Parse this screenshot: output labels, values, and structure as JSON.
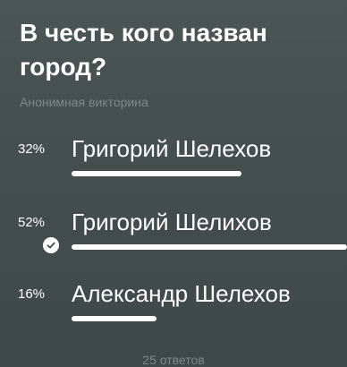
{
  "poll": {
    "question": "В честь кого назван город?",
    "subtitle": "Анонимная викторина",
    "options": [
      {
        "percent_label": "32%",
        "label": "Григорий Шелехов",
        "fraction": 0.32,
        "selected": false
      },
      {
        "percent_label": "52%",
        "label": "Григорий Шелихов",
        "fraction": 0.52,
        "selected": true
      },
      {
        "percent_label": "16%",
        "label": "Александр Шелехов",
        "fraction": 0.16,
        "selected": false
      }
    ],
    "total_votes": "25 ответов"
  },
  "colors": {
    "background": "#434d4c",
    "text": "#ffffff",
    "muted_text": "#7e8a88",
    "bar": "#ffffff"
  },
  "icons": {
    "selected_option": "checkmark-icon"
  }
}
